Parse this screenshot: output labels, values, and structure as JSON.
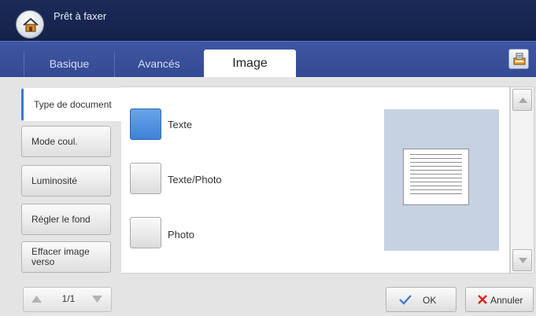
{
  "header": {
    "status": "Prêt à faxer",
    "home_icon": "home-icon"
  },
  "tabs": [
    {
      "label": "Basique",
      "active": false
    },
    {
      "label": "Avancés",
      "active": false
    },
    {
      "label": "Image",
      "active": true
    }
  ],
  "toolbar": {
    "job_icon": "job-status-icon"
  },
  "sidebar": {
    "items": [
      {
        "label": "Type de document",
        "active": true
      },
      {
        "label": "Mode coul.",
        "active": false
      },
      {
        "label": "Luminosité",
        "active": false
      },
      {
        "label": "Régler le fond",
        "active": false
      },
      {
        "label": "Effacer image verso",
        "active": false
      }
    ]
  },
  "options": [
    {
      "label": "Texte",
      "selected": true
    },
    {
      "label": "Texte/Photo",
      "selected": false
    },
    {
      "label": "Photo",
      "selected": false
    }
  ],
  "preview": {
    "icon": "document-preview-icon"
  },
  "pager": {
    "text": "1/1"
  },
  "actions": {
    "ok_label": "OK",
    "cancel_label": "Annuler"
  },
  "colors": {
    "header": "#1b2b57",
    "tabbar": "#3e56a2",
    "accent": "#3a77d1",
    "selected": "#4f90e0",
    "preview_bg": "#c6d2e2",
    "cancel_x": "#e02020",
    "ok_check": "#3a77d1"
  }
}
